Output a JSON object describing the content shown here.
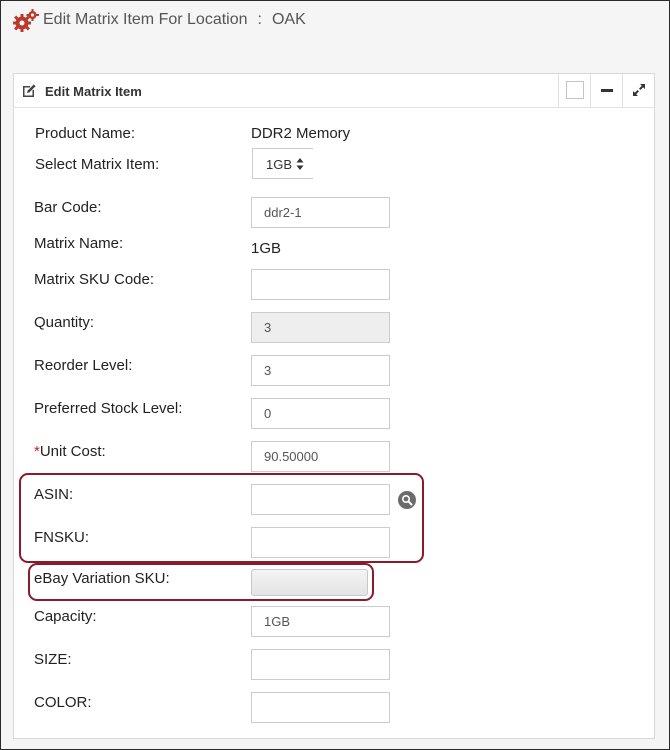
{
  "page": {
    "title_prefix": "Edit Matrix Item For Location",
    "title_separator": ":",
    "location": "OAK"
  },
  "panel": {
    "title": "Edit Matrix Item"
  },
  "form": {
    "product_name_label": "Product Name:",
    "product_name_value": "DDR2 Memory",
    "select_matrix_label": "Select Matrix Item:",
    "select_matrix_value": "1GB",
    "bar_code_label": "Bar Code:",
    "bar_code_value": "ddr2-1",
    "matrix_name_label": "Matrix Name:",
    "matrix_name_value": "1GB",
    "matrix_sku_label": "Matrix SKU Code:",
    "matrix_sku_value": "",
    "quantity_label": "Quantity:",
    "quantity_value": "3",
    "reorder_label": "Reorder Level:",
    "reorder_value": "3",
    "preferred_stock_label": "Preferred Stock Level:",
    "preferred_stock_value": "0",
    "unit_cost_required_mark": "*",
    "unit_cost_label": "Unit Cost:",
    "unit_cost_value": "90.50000",
    "asin_label": "ASIN:",
    "asin_value": "",
    "fnsku_label": "FNSKU:",
    "fnsku_value": "",
    "ebay_sku_label": "eBay Variation SKU:",
    "capacity_label": "Capacity:",
    "capacity_value": "1GB",
    "size_label": "SIZE:",
    "size_value": "",
    "color_label": "COLOR:",
    "color_value": ""
  },
  "colors": {
    "highlight": "#8b1a2b",
    "gears_icon": "#b83a2e",
    "required": "#cc1f1f"
  },
  "icons": {
    "header": "gears-icon",
    "panel": "edit-icon",
    "search": "search-icon"
  }
}
